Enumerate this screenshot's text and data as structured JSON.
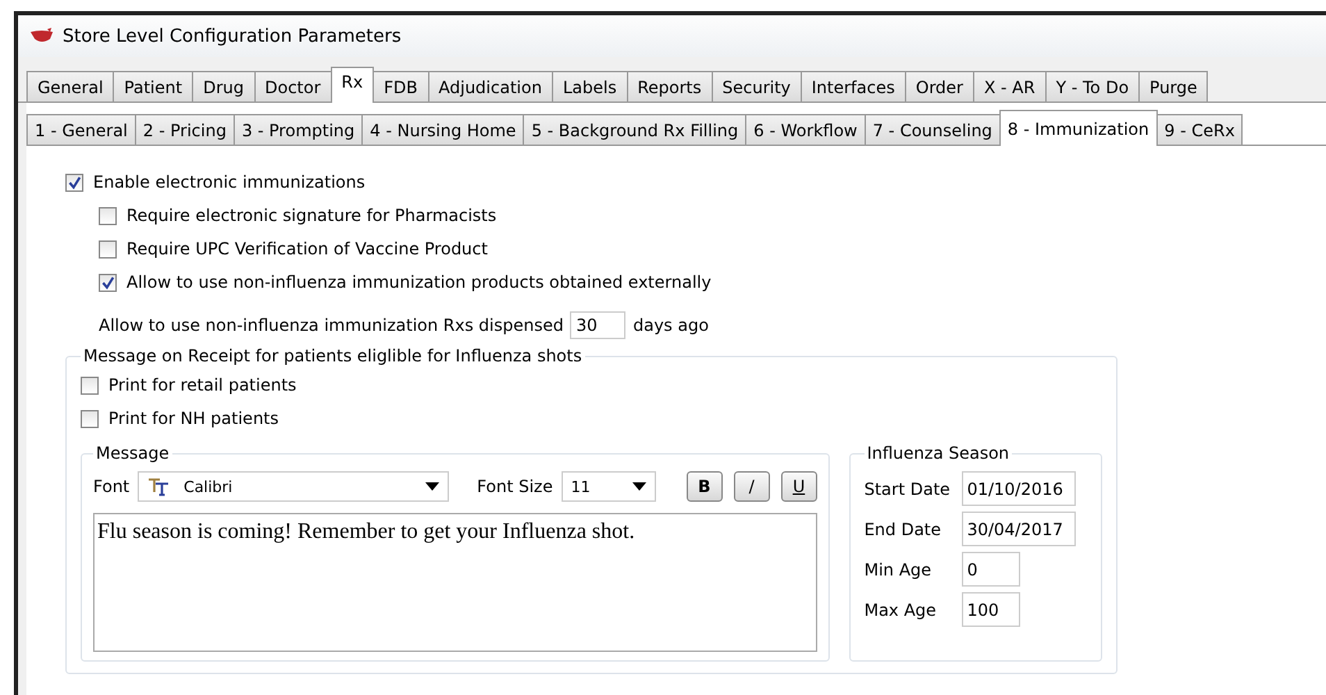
{
  "window": {
    "title": "Store Level Configuration Parameters"
  },
  "tabs": [
    {
      "label": "General",
      "selected": false
    },
    {
      "label": "Patient",
      "selected": false
    },
    {
      "label": "Drug",
      "selected": false
    },
    {
      "label": "Doctor",
      "selected": false
    },
    {
      "label": "Rx",
      "selected": true
    },
    {
      "label": "FDB",
      "selected": false
    },
    {
      "label": "Adjudication",
      "selected": false
    },
    {
      "label": "Labels",
      "selected": false
    },
    {
      "label": "Reports",
      "selected": false
    },
    {
      "label": "Security",
      "selected": false
    },
    {
      "label": "Interfaces",
      "selected": false
    },
    {
      "label": "Order",
      "selected": false
    },
    {
      "label": "X - AR",
      "selected": false
    },
    {
      "label": "Y - To Do",
      "selected": false
    },
    {
      "label": "Purge",
      "selected": false
    }
  ],
  "subtabs": [
    {
      "label": "1 - General",
      "selected": false
    },
    {
      "label": "2 - Pricing",
      "selected": false
    },
    {
      "label": "3 - Prompting",
      "selected": false
    },
    {
      "label": "4 - Nursing Home",
      "selected": false
    },
    {
      "label": "5 - Background Rx Filling",
      "selected": false
    },
    {
      "label": "6 - Workflow",
      "selected": false
    },
    {
      "label": "7 - Counseling",
      "selected": false
    },
    {
      "label": "8 - Immunization",
      "selected": true
    },
    {
      "label": "9 - CeRx",
      "selected": false
    }
  ],
  "enable": {
    "label": "Enable electronic immunizations",
    "checked": true
  },
  "options": [
    {
      "label": "Require electronic signature for Pharmacists",
      "checked": false
    },
    {
      "label": "Require UPC Verification of Vaccine Product",
      "checked": false
    },
    {
      "label": "Allow to use non-influenza immunization products obtained externally",
      "checked": true
    }
  ],
  "days_row": {
    "label": "Allow to use non-influenza immunization Rxs dispensed",
    "value": "30",
    "suffix": "days ago"
  },
  "receipt": {
    "title": "Message on Receipt for patients eliglible for Influenza shots",
    "prints": [
      {
        "label": "Print for retail patients",
        "checked": false
      },
      {
        "label": "Print for NH patients",
        "checked": false
      }
    ],
    "message": {
      "title": "Message",
      "font_label": "Font",
      "font": "Calibri",
      "size_label": "Font Size",
      "size": "11",
      "style_buttons": [
        {
          "label": "B",
          "kind": "bold"
        },
        {
          "label": "/",
          "kind": "italic"
        },
        {
          "label": "U",
          "kind": "underline"
        }
      ],
      "text": "Flu season is coming! Remember to get your Influenza shot."
    },
    "season": {
      "title": "Influenza Season",
      "fields": [
        {
          "label": "Start Date",
          "value": "01/10/2016",
          "kind": "wide"
        },
        {
          "label": "End Date",
          "value": "30/04/2017",
          "kind": "wide"
        },
        {
          "label": "Min Age",
          "value": "0",
          "kind": "narrow"
        },
        {
          "label": "Max Age",
          "value": "100",
          "kind": "narrow"
        }
      ]
    }
  }
}
